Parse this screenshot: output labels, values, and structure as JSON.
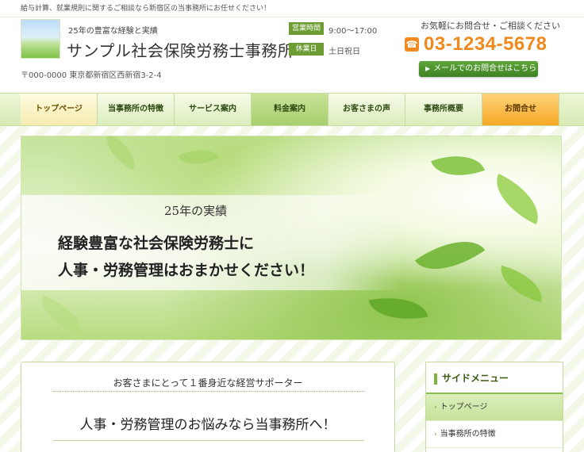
{
  "topbar": {
    "text": "給与計算、就業規則に関するご相談なら新宿区の当事務所にお任せください！"
  },
  "header": {
    "tagline": "25年の豊富な経験と実績",
    "office_name": "サンプル社会保険労務士事務所",
    "address": "〒000-0000 東京都新宿区西新宿3-2-4",
    "hours_label": "営業時間",
    "hours_value": "9:00～17:00",
    "closed_label": "休業日",
    "closed_value": "土日祝日",
    "contact_lead": "お気軽にお問合せ・ご相談ください",
    "phone": "03-1234-5678",
    "mail_button": "メールでのお問合せはこちら"
  },
  "nav": {
    "items": [
      {
        "label": "トップページ"
      },
      {
        "label": "当事務所の特徴"
      },
      {
        "label": "サービス案内"
      },
      {
        "label": "料金案内"
      },
      {
        "label": "お客さまの声"
      },
      {
        "label": "事務所概要"
      },
      {
        "label": "お問合せ"
      }
    ]
  },
  "hero": {
    "subtitle": "25年の実績",
    "line1": "経験豊富な社会保険労務士に",
    "line2": "人事・労務管理はおまかせください！"
  },
  "main": {
    "lead": "お客さまにとって１番身近な経営サポーター",
    "heading": "人事・労務管理のお悩みなら当事務所へ！"
  },
  "sidemenu": {
    "title": "サイドメニュー",
    "items": [
      {
        "label": "トップページ"
      },
      {
        "label": "当事務所の特徴"
      }
    ]
  },
  "colors": {
    "accent_green": "#6d9c33",
    "phone_orange": "#f08a1c",
    "nav_active": "#f4ecb0",
    "nav_contact": "#f5a826"
  },
  "icons": {
    "phone": "phone-icon",
    "mail_arrow": "chevron-right-icon"
  }
}
